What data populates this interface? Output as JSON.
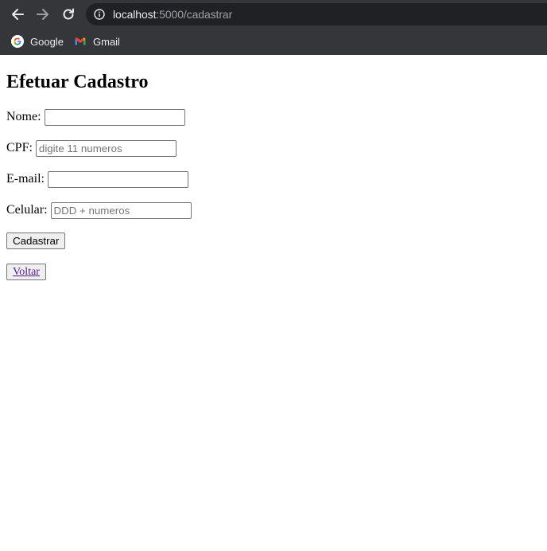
{
  "browser": {
    "url_host": "localhost",
    "url_rest": ":5000/cadastrar",
    "bookmarks": [
      {
        "label": "Google",
        "icon": "google-icon"
      },
      {
        "label": "Gmail",
        "icon": "gmail-icon"
      }
    ],
    "colors": {
      "toolbar_bg": "#35363a",
      "omnibox_bg": "#202124",
      "text": "#e8eaed"
    }
  },
  "page": {
    "title": "Efetuar Cadastro",
    "fields": {
      "nome": {
        "label": "Nome:",
        "value": "",
        "placeholder": ""
      },
      "cpf": {
        "label": "CPF:",
        "value": "",
        "placeholder": "digite 11 numeros"
      },
      "email": {
        "label": "E-mail:",
        "value": "",
        "placeholder": ""
      },
      "celular": {
        "label": "Celular:",
        "value": "",
        "placeholder": "DDD + numeros"
      }
    },
    "submit_label": "Cadastrar",
    "back_label": "Voltar",
    "colors": {
      "link": "#551a8b"
    }
  }
}
